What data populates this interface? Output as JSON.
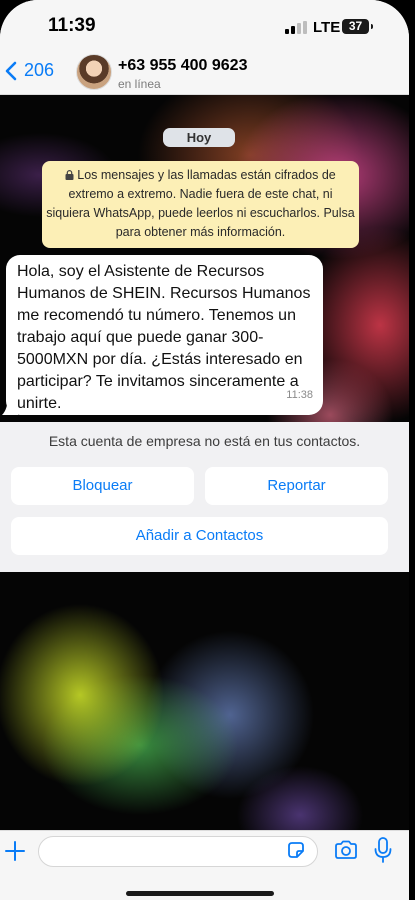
{
  "status_bar": {
    "time": "11:39",
    "network": "LTE",
    "battery": "37"
  },
  "header": {
    "back_count": "206",
    "contact_name": "+63 955 400 9623",
    "contact_status": "en línea"
  },
  "chat": {
    "day_label": "Hoy",
    "encryption_notice": "Los mensajes y las llamadas están cifrados de extremo a extremo. Nadie fuera de este chat, ni siquiera WhatsApp, puede leerlos ni escucharlos. Pulsa para obtener más información.",
    "messages": [
      {
        "text": "Hola, soy el Asistente de Recursos Humanos de SHEIN. Recursos Humanos me recomendó tu número. Tenemos un trabajo aquí que puede ganar 300-5000MXN por día. ¿Estás interesado en participar? Te invitamos sinceramente a unirte.",
        "time": "11:38"
      }
    ]
  },
  "business_panel": {
    "note": "Esta cuenta de empresa no está en tus contactos.",
    "block_label": "Bloquear",
    "report_label": "Reportar",
    "add_contact_label": "Añadir a Contactos"
  },
  "input": {
    "placeholder": ""
  },
  "colors": {
    "accent": "#0a7cf6",
    "encryption_bg": "#fcefb6",
    "panel_bg": "#f1f1f3"
  },
  "icons": [
    "back-chevron-icon",
    "lock-icon",
    "plus-icon",
    "sticker-icon",
    "camera-icon",
    "mic-icon"
  ]
}
